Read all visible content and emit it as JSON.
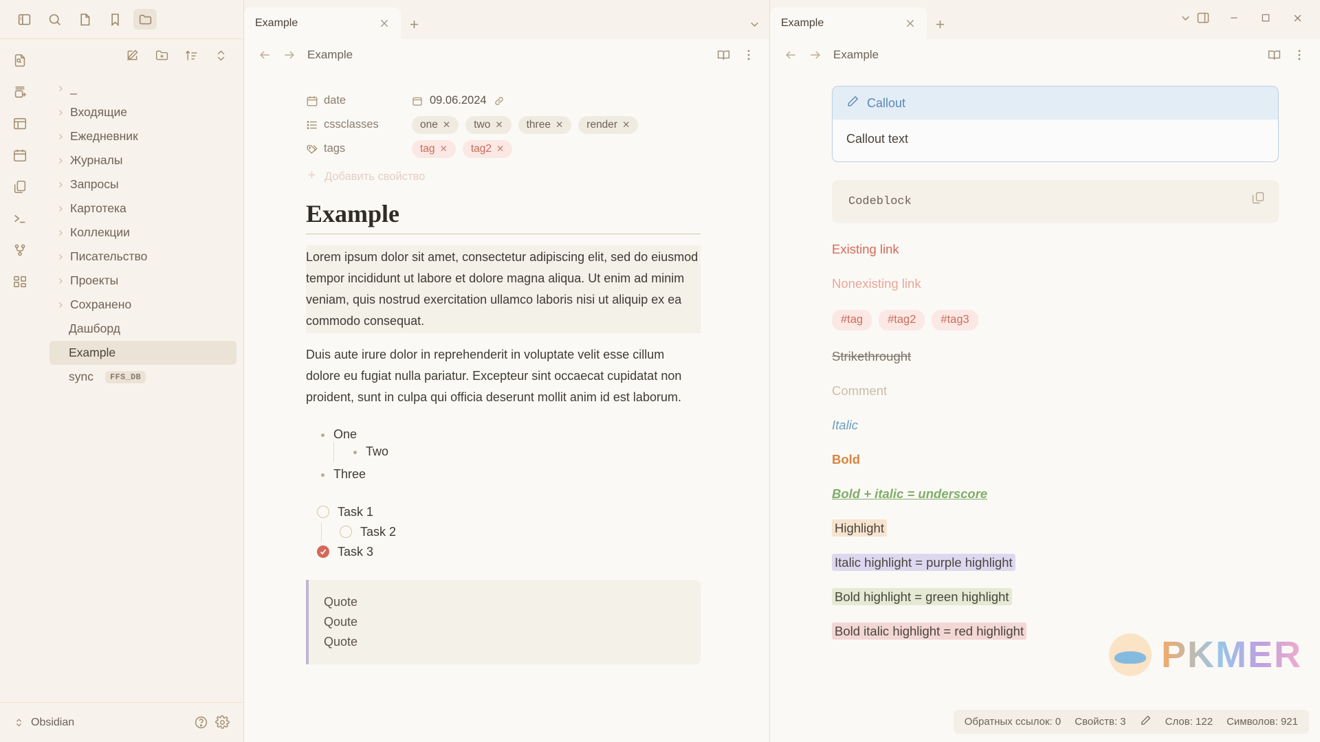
{
  "left_sidebar": {
    "top_icons": [
      {
        "name": "toggle-sidebar-icon",
        "label": "Toggle sidebar"
      },
      {
        "name": "search-icon",
        "label": "Search"
      },
      {
        "name": "new-note-icon",
        "label": "New note"
      },
      {
        "name": "bookmark-icon",
        "label": "Bookmarks"
      },
      {
        "name": "folder-icon",
        "label": "Files",
        "active": true
      }
    ],
    "rail_icons": [
      {
        "name": "file-search-icon"
      },
      {
        "name": "add-card-icon"
      },
      {
        "name": "layout-icon"
      },
      {
        "name": "calendar-icon"
      },
      {
        "name": "copy-files-icon"
      },
      {
        "name": "terminal-icon"
      },
      {
        "name": "git-branch-icon"
      },
      {
        "name": "dashboard-grid-icon"
      }
    ],
    "actions": [
      {
        "name": "new-note-action-icon"
      },
      {
        "name": "new-folder-action-icon"
      },
      {
        "name": "sort-action-icon"
      },
      {
        "name": "expand-collapse-action-icon"
      }
    ],
    "tree": [
      {
        "label": "_",
        "type": "folder"
      },
      {
        "label": "Входящие",
        "type": "folder"
      },
      {
        "label": "Ежедневник",
        "type": "folder"
      },
      {
        "label": "Журналы",
        "type": "folder"
      },
      {
        "label": "Запросы",
        "type": "folder"
      },
      {
        "label": "Картотека",
        "type": "folder"
      },
      {
        "label": "Коллекции",
        "type": "folder"
      },
      {
        "label": "Писательство",
        "type": "folder"
      },
      {
        "label": "Проекты",
        "type": "folder"
      },
      {
        "label": "Сохранено",
        "type": "folder"
      },
      {
        "label": "Дашборд",
        "type": "file"
      },
      {
        "label": "Example",
        "type": "file",
        "selected": true
      },
      {
        "label": "sync",
        "type": "file",
        "badge": "FFS_DB"
      }
    ],
    "footer": {
      "vault_label": "Obsidian",
      "help_icon": "help-icon",
      "settings_icon": "gear-icon"
    }
  },
  "middle_pane": {
    "tab": {
      "title": "Example",
      "close_icon": "close-icon"
    },
    "new_tab_icon": "plus-icon",
    "tabbar_menu_icon": "chevron-down-icon",
    "view_header": {
      "back_icon": "arrow-left-icon",
      "forward_icon": "arrow-right-icon",
      "title": "Example",
      "reading_icon": "book-open-icon",
      "more_icon": "more-vertical-icon"
    },
    "properties": [
      {
        "key": "date",
        "icon": "calendar-icon",
        "type": "date",
        "value": "09.06.2024",
        "link_icon": "link-icon"
      },
      {
        "key": "cssclasses",
        "icon": "list-icon",
        "type": "pills",
        "values": [
          "one",
          "two",
          "three",
          "render"
        ]
      },
      {
        "key": "tags",
        "icon": "tags-icon",
        "type": "tags",
        "values": [
          "tag",
          "tag2"
        ]
      }
    ],
    "add_property_label": "Добавить свойство",
    "note_title": "Example",
    "paragraphs": [
      "Lorem ipsum dolor sit amet, consectetur adipiscing elit, sed do eiusmod tempor incididunt ut labore et dolore magna aliqua. Ut enim ad minim veniam, quis nostrud exercitation ullamco laboris nisi ut aliquip ex ea commodo consequat.",
      "Duis aute irure dolor in reprehenderit in voluptate velit esse cillum dolore eu fugiat nulla pariatur. Excepteur sint occaecat cupidatat non proident, sunt in culpa qui officia deserunt mollit anim id est laborum."
    ],
    "bullets": [
      {
        "label": "One"
      },
      {
        "label": "Two",
        "nested": true
      },
      {
        "label": "Three"
      }
    ],
    "tasks": [
      {
        "label": "Task 1",
        "done": false,
        "sub": false
      },
      {
        "label": "Task 2",
        "done": false,
        "sub": true
      },
      {
        "label": "Task 3",
        "done": true,
        "sub": false
      }
    ],
    "quote_lines": [
      "Quote",
      "Qoute",
      "Quote"
    ]
  },
  "right_pane": {
    "tab": {
      "title": "Example",
      "close_icon": "close-icon"
    },
    "new_tab_icon": "plus-icon",
    "tabbar_menu_icon": "chevron-down-icon",
    "split_icon": "split-right-icon",
    "window_controls": {
      "minimize": "minimize-icon",
      "maximize": "maximize-icon",
      "close": "close-window-icon"
    },
    "view_header": {
      "back_icon": "arrow-left-icon",
      "forward_icon": "arrow-right-icon",
      "title": "Example",
      "reading_icon": "book-open-icon",
      "more_icon": "more-vertical-icon"
    },
    "callout": {
      "icon": "pencil-icon",
      "title": "Callout",
      "body": "Callout text"
    },
    "codeblock": {
      "text": "Codeblock",
      "copy_icon": "copy-icon"
    },
    "existing_link": "Existing link",
    "nonexisting_link": "Nonexisting link",
    "tags": [
      "#tag",
      "#tag2",
      "#tag3"
    ],
    "strikethrough": "Strikethrought",
    "comment": "Comment",
    "italic": "Italic",
    "bold": "Bold",
    "bold_italic": "Bold + italic = underscore",
    "highlight": "Highlight",
    "italic_highlight": "Italic highlight = purple highlight",
    "bold_highlight": "Bold highlight = green highlight",
    "bold_italic_highlight": "Bold italic highlight = red highlight"
  },
  "status_bar": {
    "backlinks": "Обратных ссылок: 0",
    "properties": "Свойств: 3",
    "edit_icon": "pencil-edit-icon",
    "words": "Слов: 122",
    "chars": "Символов: 921"
  },
  "watermark": {
    "text": "PKMER"
  },
  "colors": {
    "accent": "#d4695a",
    "sidebar_bg": "#f7f3ec",
    "note_bg": "#fbf9f5",
    "callout_blue": "#5b88b5",
    "italic_blue": "#6e9ec4",
    "bold_orange": "#d8843f",
    "bolditalic_green": "#7fae68"
  }
}
